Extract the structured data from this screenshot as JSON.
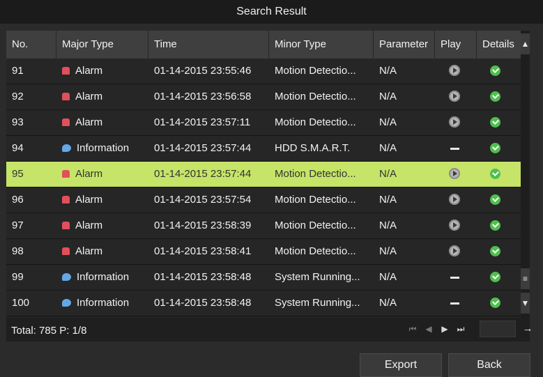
{
  "title": "Search Result",
  "columns": {
    "no": "No.",
    "major_type": "Major Type",
    "time": "Time",
    "minor_type": "Minor Type",
    "parameter": "Parameter",
    "play": "Play",
    "details": "Details"
  },
  "rows": [
    {
      "no": "91",
      "major": "Alarm",
      "major_icon": "alarm-icon",
      "time": "01-14-2015 23:55:46",
      "minor": "Motion Detectio...",
      "param": "N/A",
      "play": "play-icon",
      "details": "check-icon"
    },
    {
      "no": "92",
      "major": "Alarm",
      "major_icon": "alarm-icon",
      "time": "01-14-2015 23:56:58",
      "minor": "Motion Detectio...",
      "param": "N/A",
      "play": "play-icon",
      "details": "check-icon"
    },
    {
      "no": "93",
      "major": "Alarm",
      "major_icon": "alarm-icon",
      "time": "01-14-2015 23:57:11",
      "minor": "Motion Detectio...",
      "param": "N/A",
      "play": "play-icon",
      "details": "check-icon"
    },
    {
      "no": "94",
      "major": "Information",
      "major_icon": "info-icon",
      "time": "01-14-2015 23:57:44",
      "minor": "HDD S.M.A.R.T.",
      "param": "N/A",
      "play": "dash-icon",
      "details": "check-icon"
    },
    {
      "no": "95",
      "major": "Alarm",
      "major_icon": "alarm-icon",
      "time": "01-14-2015 23:57:44",
      "minor": "Motion Detectio...",
      "param": "N/A",
      "play": "play-icon",
      "details": "check-icon",
      "selected": true
    },
    {
      "no": "96",
      "major": "Alarm",
      "major_icon": "alarm-icon",
      "time": "01-14-2015 23:57:54",
      "minor": "Motion Detectio...",
      "param": "N/A",
      "play": "play-icon",
      "details": "check-icon"
    },
    {
      "no": "97",
      "major": "Alarm",
      "major_icon": "alarm-icon",
      "time": "01-14-2015 23:58:39",
      "minor": "Motion Detectio...",
      "param": "N/A",
      "play": "play-icon",
      "details": "check-icon"
    },
    {
      "no": "98",
      "major": "Alarm",
      "major_icon": "alarm-icon",
      "time": "01-14-2015 23:58:41",
      "minor": "Motion Detectio...",
      "param": "N/A",
      "play": "play-icon",
      "details": "check-icon"
    },
    {
      "no": "99",
      "major": "Information",
      "major_icon": "info-icon",
      "time": "01-14-2015 23:58:48",
      "minor": "System Running...",
      "param": "N/A",
      "play": "dash-icon",
      "details": "check-icon"
    },
    {
      "no": "100",
      "major": "Information",
      "major_icon": "info-icon",
      "time": "01-14-2015 23:58:48",
      "minor": "System Running...",
      "param": "N/A",
      "play": "dash-icon",
      "details": "check-icon"
    }
  ],
  "footer": {
    "total": "Total: 785  P: 1/8",
    "first_icon": "first-page-icon",
    "prev_icon": "prev-page-icon",
    "next_icon": "next-page-icon",
    "last_icon": "last-page-icon",
    "go_icon": "go-arrow-icon"
  },
  "buttons": {
    "export": "Export",
    "back": "Back"
  },
  "colors": {
    "selected_row": "#c6e468",
    "check": "#4fbf4f",
    "alarm": "#e0505a",
    "info": "#62a8e8"
  }
}
